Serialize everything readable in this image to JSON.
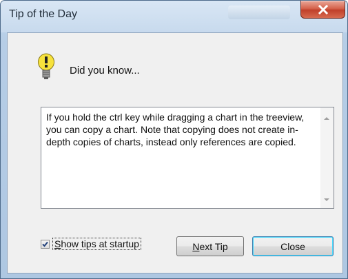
{
  "window": {
    "title": "Tip of the Day"
  },
  "header": {
    "did_you_know": "Did you know..."
  },
  "tip": {
    "text": "If you hold the ctrl key while dragging a chart in the treeview, you can copy a chart. Note that copying does not create in-depth copies of charts, instead only references are copied."
  },
  "startup": {
    "label_first": "S",
    "label_rest": "how tips at startup",
    "checked": true
  },
  "buttons": {
    "next_first": "N",
    "next_rest": "ext Tip",
    "close": "Close"
  },
  "icons": {
    "bulb": "lightbulb-icon",
    "close": "close-icon",
    "check": "checkmark-icon"
  },
  "colors": {
    "close_button": "#c0402a",
    "bulb_yellow": "#f7e23c",
    "focus_blue": "#3c7fb1"
  }
}
